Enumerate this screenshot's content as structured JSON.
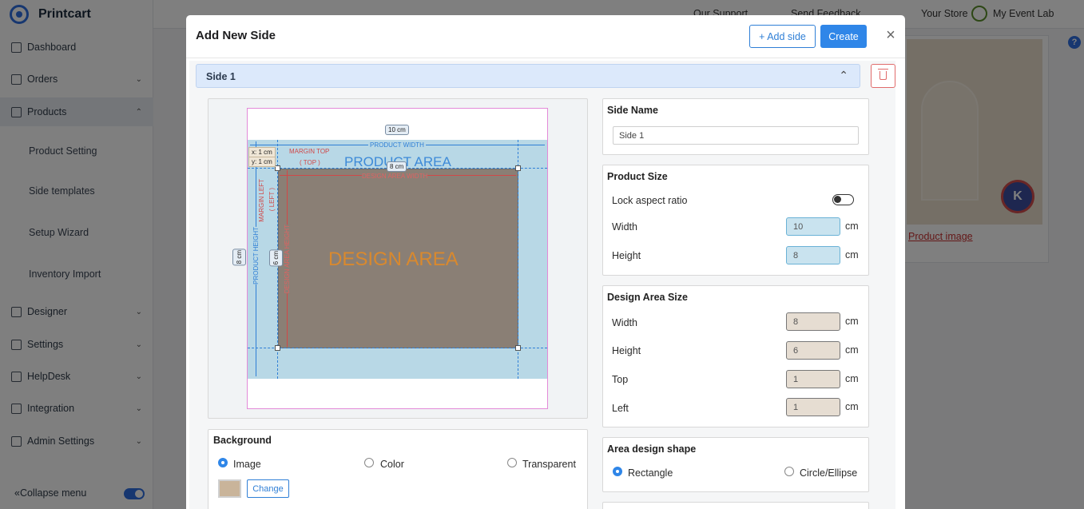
{
  "app": {
    "brand": "Printcart",
    "collapse_label": "Collapse menu",
    "topbar": {
      "support": "Our Support",
      "feedback": "Send Feedback",
      "store": "Your Store",
      "account": "My Event Lab"
    },
    "nav": [
      {
        "label": "Dashboard"
      },
      {
        "label": "Orders"
      },
      {
        "label": "Products"
      },
      {
        "label": "Designer"
      },
      {
        "label": "Settings"
      },
      {
        "label": "HelpDesk"
      },
      {
        "label": "Integration"
      },
      {
        "label": "Admin Settings"
      }
    ],
    "subnav": [
      "Product Setting",
      "Side templates",
      "Setup Wizard",
      "Inventory Import"
    ],
    "card_link": "Product image"
  },
  "modal": {
    "title": "Add New Side",
    "add_side_label": "+ Add side",
    "create_label": "Create",
    "side_header": "Side 1",
    "canvas": {
      "product_area_label": "PRODUCT AREA",
      "design_area_label": "DESIGN AREA",
      "product_width_label": "PRODUCT WIDTH",
      "product_height_label": "PRODUCT HEIGHT",
      "design_width_label": "DESIGN AREA WIDTH",
      "design_height_label": "DESIGN AREA HEIGHT",
      "margin_top_label": "MARGIN TOP",
      "margin_top_sub": "( TOP )",
      "margin_left_label": "MARGIN LEFT",
      "margin_left_sub": "( LEFT )",
      "width_pill": "10 cm",
      "height_pill": "8 cm",
      "design_width_pill": "8 cm",
      "design_height_pill": "6 cm",
      "x_coord": "x: 1 cm",
      "y_coord": "y: 1 cm"
    },
    "side_name": {
      "title": "Side Name",
      "value": "Side 1"
    },
    "product_size": {
      "title": "Product Size",
      "lock_label": "Lock aspect ratio",
      "width_label": "Width",
      "width_value": "10",
      "height_label": "Height",
      "height_value": "8",
      "unit": "cm"
    },
    "design_area_size": {
      "title": "Design Area Size",
      "width_label": "Width",
      "width_value": "8",
      "height_label": "Height",
      "height_value": "6",
      "top_label": "Top",
      "top_value": "1",
      "left_label": "Left",
      "left_value": "1",
      "unit": "cm"
    },
    "area_shape": {
      "title": "Area design shape",
      "rect": "Rectangle",
      "circle": "Circle/Ellipse",
      "selected": "Rectangle"
    },
    "background": {
      "title": "Background",
      "image": "Image",
      "color": "Color",
      "transparent": "Transparent",
      "selected": "Image",
      "change_label": "Change"
    }
  }
}
